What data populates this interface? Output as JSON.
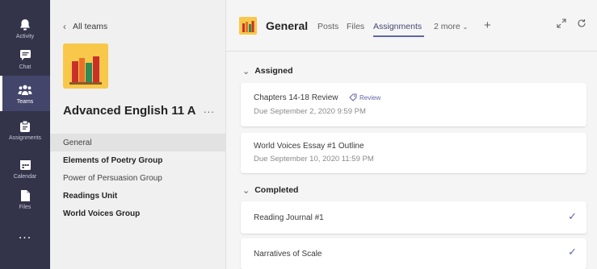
{
  "rail": {
    "items": [
      {
        "label": "Activity",
        "icon": "bell-icon"
      },
      {
        "label": "Chat",
        "icon": "chat-icon"
      },
      {
        "label": "Teams",
        "icon": "teams-icon"
      },
      {
        "label": "Assignments",
        "icon": "assignments-icon"
      },
      {
        "label": "Calendar",
        "icon": "calendar-icon"
      },
      {
        "label": "Files",
        "icon": "files-icon"
      }
    ],
    "more": "..."
  },
  "teampanel": {
    "back_label": "All teams",
    "team_name": "Advanced English 11 A",
    "more": "...",
    "channels": [
      {
        "label": "General"
      },
      {
        "label": "Elements of Poetry Group"
      },
      {
        "label": "Power of Persuasion Group"
      },
      {
        "label": "Readings Unit"
      },
      {
        "label": "World Voices Group"
      }
    ]
  },
  "header": {
    "title": "General",
    "tabs": [
      {
        "label": "Posts"
      },
      {
        "label": "Files"
      },
      {
        "label": "Assignments"
      },
      {
        "label": "2 more"
      }
    ],
    "add": "+"
  },
  "sections": {
    "assigned": {
      "label": "Assigned",
      "items": [
        {
          "title": "Chapters 14-18 Review",
          "badge": "Review",
          "due": "Due September 2, 2020 9:59 PM"
        },
        {
          "title": "World Voices Essay #1 Outline",
          "due": "Due September 10, 2020 11:59 PM"
        }
      ]
    },
    "completed": {
      "label": "Completed",
      "items": [
        {
          "title": "Reading Journal #1"
        },
        {
          "title": "Narratives of Scale"
        }
      ]
    }
  },
  "colors": {
    "rail_bg": "#33344a",
    "accent": "#6264a7",
    "logo_bg": "#f7c84a"
  }
}
